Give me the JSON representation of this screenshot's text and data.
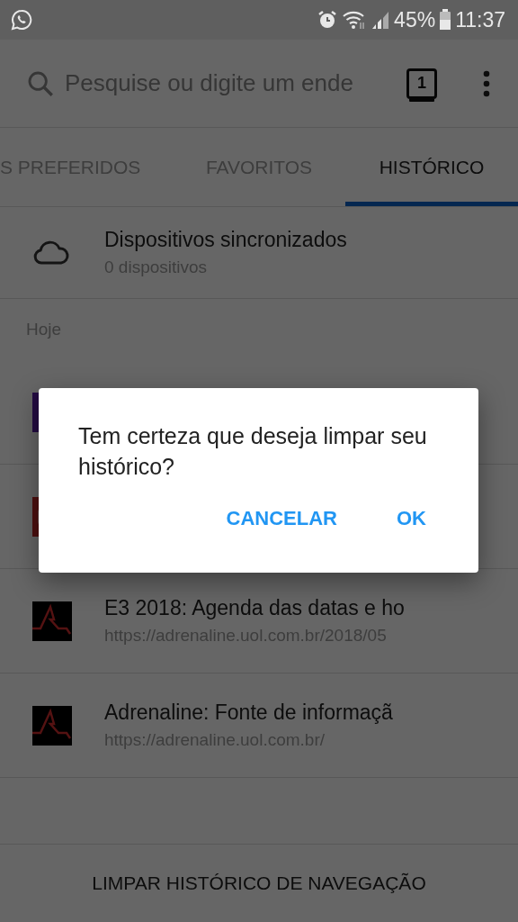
{
  "status_bar": {
    "battery": "45%",
    "time": "11:37"
  },
  "toolbar": {
    "search": {
      "placeholder": "Pesquise ou digite um ende"
    },
    "tab_count": "1"
  },
  "tabs": [
    {
      "label": "S PREFERIDOS",
      "selected": false
    },
    {
      "label": "FAVORITOS",
      "selected": false
    },
    {
      "label": "HISTÓRICO",
      "selected": true
    }
  ],
  "synced_devices": {
    "title": "Dispositivos sincronizados",
    "subtitle": "0 dispositivos"
  },
  "history": {
    "section": "Hoje",
    "items": [
      {
        "kind": "purple-tile"
      },
      {
        "kind": "red-tile"
      },
      {
        "kind": "adrenaline",
        "title": "E3 2018: Agenda das datas e ho",
        "url": "https://adrenaline.uol.com.br/2018/05"
      },
      {
        "kind": "adrenaline",
        "title": "Adrenaline: Fonte de informaçã",
        "url": "https://adrenaline.uol.com.br/"
      }
    ]
  },
  "clear_button": "LIMPAR HISTÓRICO DE NAVEGAÇÃO",
  "dialog": {
    "message": "Tem certeza que deseja limpar seu histórico?",
    "buttons": [
      "CANCELAR",
      "OK"
    ]
  }
}
